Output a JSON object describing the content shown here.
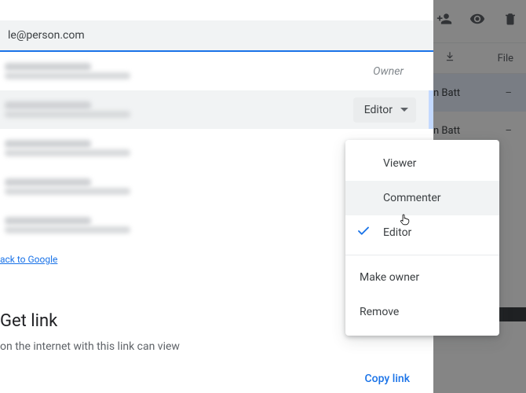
{
  "share": {
    "email_input": "le@person.com",
    "owner_label": "Owner",
    "editor_chip_label": "Editor",
    "feedback_link": "ack to Google"
  },
  "dropdown": {
    "viewer": "Viewer",
    "commenter": "Commenter",
    "editor": "Editor",
    "make_owner": "Make owner",
    "remove": "Remove",
    "selected": "editor",
    "hovered": "commenter"
  },
  "get_link": {
    "title": "Get link",
    "subtitle": "on the internet with this link can view",
    "copy_label": "Copy link"
  },
  "background": {
    "file_header": "File",
    "rows": [
      {
        "owner": "n Batt",
        "file": "–"
      },
      {
        "owner": "n Batt",
        "file": "–"
      }
    ]
  },
  "people": [
    {
      "role": "owner"
    },
    {
      "role": "editor",
      "highlighted": true
    },
    {
      "role": "none"
    },
    {
      "role": "none"
    },
    {
      "role": "none"
    }
  ]
}
